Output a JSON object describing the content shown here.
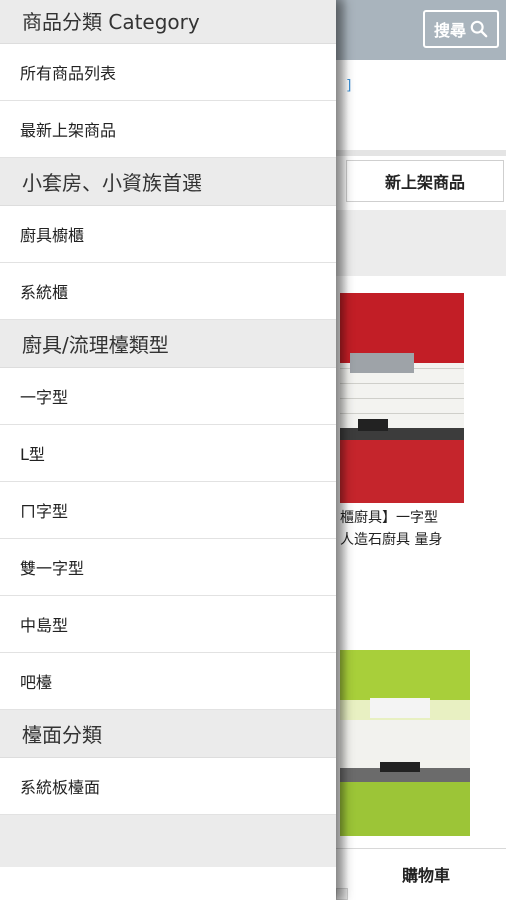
{
  "header": {
    "search_label": "搜尋",
    "search_icon": "magnifier-icon"
  },
  "background": {
    "new_tab_label": "新上架商品",
    "product1_caption_line1": "櫃廚具】一字型",
    "product1_caption_line2": "人造石廚具 量身",
    "cart_label": "購物車"
  },
  "drawer": {
    "sections": [
      {
        "title": "商品分類 Category",
        "items": [
          "所有商品列表",
          "最新上架商品"
        ]
      },
      {
        "title": "小套房、小資族首選",
        "items": [
          "廚具櫥櫃",
          "系統櫃"
        ]
      },
      {
        "title": "廚具/流理檯類型",
        "items": [
          "一字型",
          "L型",
          "ㄇ字型",
          "雙一字型",
          "中島型",
          "吧檯"
        ]
      },
      {
        "title": "檯面分類",
        "items": [
          "系統板檯面"
        ]
      }
    ]
  },
  "colors": {
    "header_bg": "#a9b4bd",
    "section_bg": "#ebebeb",
    "kitchen_red": "#c21e26",
    "kitchen_green": "#a8cf3a"
  }
}
